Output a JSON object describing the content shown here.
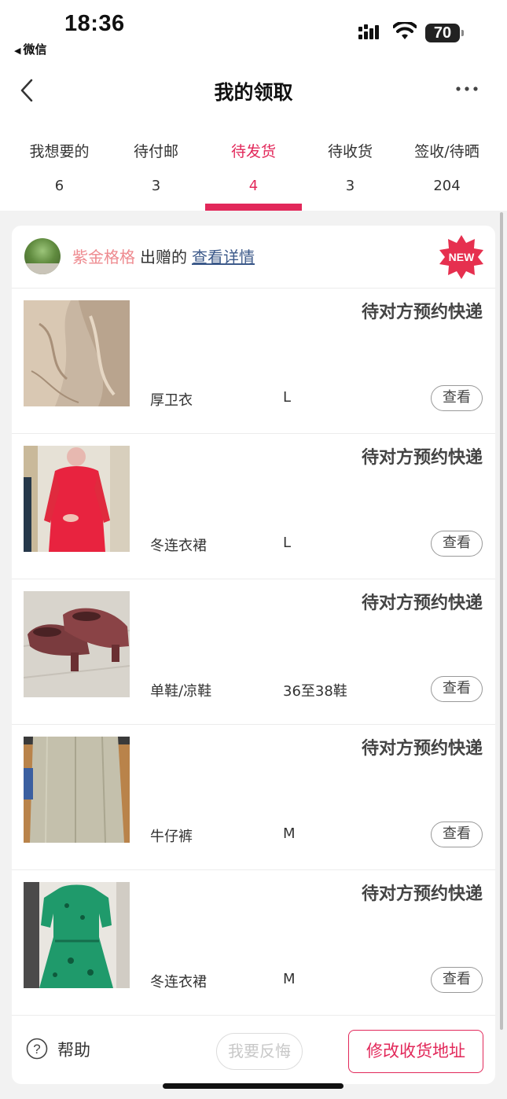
{
  "status_bar": {
    "time": "18:36",
    "back_app": "微信",
    "battery": "70"
  },
  "nav": {
    "title": "我的领取"
  },
  "tabs": [
    {
      "label": "我想要的",
      "count": "6",
      "active": false
    },
    {
      "label": "待付邮",
      "count": "3",
      "active": false
    },
    {
      "label": "待发货",
      "count": "4",
      "active": true
    },
    {
      "label": "待收货",
      "count": "3",
      "active": false
    },
    {
      "label": "签收/待晒",
      "count": "204",
      "active": false
    }
  ],
  "card": {
    "giver_name": "紫金格格",
    "giver_suffix": "出赠的",
    "detail_link": "查看详情",
    "new_badge": "NEW",
    "items": [
      {
        "status": "待对方预约快递",
        "name": "厚卫衣",
        "size": "L",
        "view": "查看"
      },
      {
        "status": "待对方预约快递",
        "name": "冬连衣裙",
        "size": "L",
        "view": "查看"
      },
      {
        "status": "待对方预约快递",
        "name": "单鞋/凉鞋",
        "size": "36至38鞋",
        "view": "查看"
      },
      {
        "status": "待对方预约快递",
        "name": "牛仔裤",
        "size": "M",
        "view": "查看"
      },
      {
        "status": "待对方预约快递",
        "name": "冬连衣裙",
        "size": "M",
        "view": "查看"
      }
    ],
    "footer": {
      "help": "帮助",
      "regret": "我要反悔",
      "modify_address": "修改收货地址"
    }
  },
  "colors": {
    "accent": "#e2285a",
    "giver_name": "#ee8a8f",
    "link": "#3d5a8a"
  }
}
